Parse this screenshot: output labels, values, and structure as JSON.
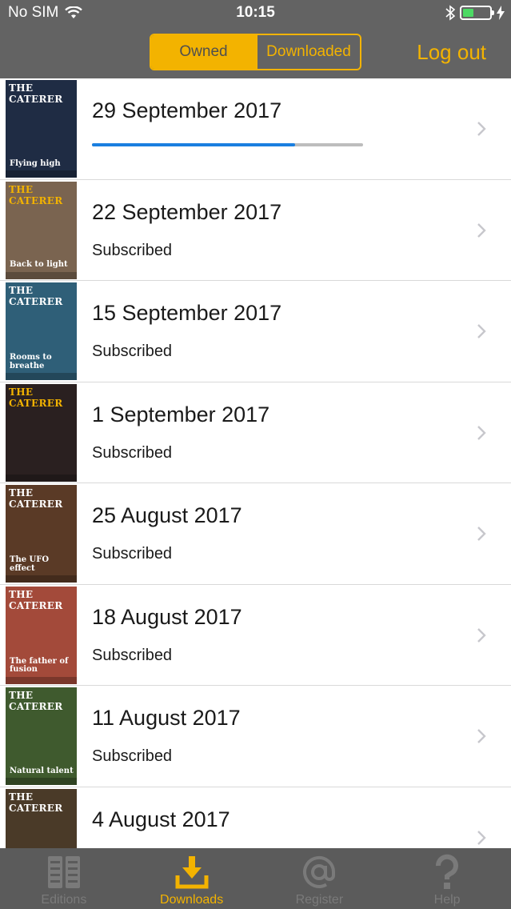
{
  "status_bar": {
    "carrier": "No SIM",
    "time": "10:15",
    "battery_level": 0.35
  },
  "nav": {
    "segments": [
      "Owned",
      "Downloaded"
    ],
    "selected_segment": "Owned",
    "logout_label": "Log out"
  },
  "colors": {
    "accent": "#f3b300",
    "header": "#636363",
    "tabbar": "#5b5b5b",
    "progress": "#1a7fe0"
  },
  "editions": [
    {
      "date": "29 September 2017",
      "status": "",
      "download_progress": 0.75,
      "cover": {
        "masthead": "THE CATERER",
        "headline": "Flying high",
        "bg": "#1f2c44",
        "mast_color": "#ffffff"
      }
    },
    {
      "date": "22 September 2017",
      "status": "Subscribed",
      "cover": {
        "masthead": "THE CATERER",
        "headline": "Back to light",
        "bg": "#7a6450",
        "mast_color": "#f3b300"
      }
    },
    {
      "date": "15 September 2017",
      "status": "Subscribed",
      "cover": {
        "masthead": "THE CATERER",
        "headline": "Rooms to breathe",
        "bg": "#2f5f78",
        "mast_color": "#ffffff"
      }
    },
    {
      "date": "1 September 2017",
      "status": "Subscribed",
      "cover": {
        "masthead": "THE CATERER",
        "headline": "",
        "bg": "#2a2020",
        "mast_color": "#f3b300"
      }
    },
    {
      "date": "25 August 2017",
      "status": "Subscribed",
      "cover": {
        "masthead": "THE CATERER",
        "headline": "The UFO effect",
        "bg": "#5a3a26",
        "mast_color": "#ffffff"
      }
    },
    {
      "date": "18 August 2017",
      "status": "Subscribed",
      "cover": {
        "masthead": "THE CATERER",
        "headline": "The father of fusion",
        "bg": "#a34a3a",
        "mast_color": "#ffffff"
      }
    },
    {
      "date": "11 August 2017",
      "status": "Subscribed",
      "cover": {
        "masthead": "THE CATERER",
        "headline": "Natural talent",
        "bg": "#3f5a2e",
        "mast_color": "#ffffff"
      }
    },
    {
      "date": "4 August 2017",
      "status": "",
      "cover": {
        "masthead": "THE CATERER",
        "headline": "",
        "bg": "#4a3a28",
        "mast_color": "#ffffff"
      }
    }
  ],
  "tabbar": {
    "tabs": [
      {
        "label": "Editions",
        "icon": "editions-icon"
      },
      {
        "label": "Downloads",
        "icon": "download-icon"
      },
      {
        "label": "Register",
        "icon": "at-sign-icon"
      },
      {
        "label": "Help",
        "icon": "question-mark-icon"
      }
    ],
    "active": "Downloads"
  }
}
